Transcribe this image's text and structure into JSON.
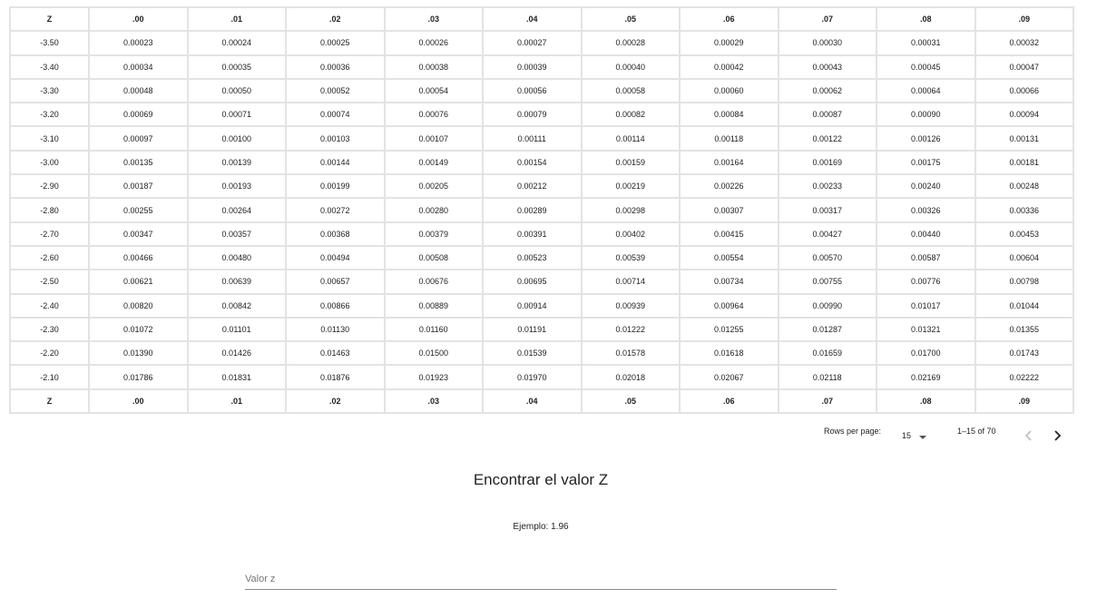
{
  "table": {
    "columns": [
      "Z",
      ".00",
      ".01",
      ".02",
      ".03",
      ".04",
      ".05",
      ".06",
      ".07",
      ".08",
      ".09"
    ],
    "rows": [
      [
        "-3.50",
        "0.00023",
        "0.00024",
        "0.00025",
        "0.00026",
        "0.00027",
        "0.00028",
        "0.00029",
        "0.00030",
        "0.00031",
        "0.00032"
      ],
      [
        "-3.40",
        "0.00034",
        "0.00035",
        "0.00036",
        "0.00038",
        "0.00039",
        "0.00040",
        "0.00042",
        "0.00043",
        "0.00045",
        "0.00047"
      ],
      [
        "-3.30",
        "0.00048",
        "0.00050",
        "0.00052",
        "0.00054",
        "0.00056",
        "0.00058",
        "0.00060",
        "0.00062",
        "0.00064",
        "0.00066"
      ],
      [
        "-3.20",
        "0.00069",
        "0.00071",
        "0.00074",
        "0.00076",
        "0.00079",
        "0.00082",
        "0.00084",
        "0.00087",
        "0.00090",
        "0.00094"
      ],
      [
        "-3.10",
        "0.00097",
        "0.00100",
        "0.00103",
        "0.00107",
        "0.00111",
        "0.00114",
        "0.00118",
        "0.00122",
        "0.00126",
        "0.00131"
      ],
      [
        "-3.00",
        "0.00135",
        "0.00139",
        "0.00144",
        "0.00149",
        "0.00154",
        "0.00159",
        "0.00164",
        "0.00169",
        "0.00175",
        "0.00181"
      ],
      [
        "-2.90",
        "0.00187",
        "0.00193",
        "0.00199",
        "0.00205",
        "0.00212",
        "0.00219",
        "0.00226",
        "0.00233",
        "0.00240",
        "0.00248"
      ],
      [
        "-2.80",
        "0.00255",
        "0.00264",
        "0.00272",
        "0.00280",
        "0.00289",
        "0.00298",
        "0.00307",
        "0.00317",
        "0.00326",
        "0.00336"
      ],
      [
        "-2.70",
        "0.00347",
        "0.00357",
        "0.00368",
        "0.00379",
        "0.00391",
        "0.00402",
        "0.00415",
        "0.00427",
        "0.00440",
        "0.00453"
      ],
      [
        "-2.60",
        "0.00466",
        "0.00480",
        "0.00494",
        "0.00508",
        "0.00523",
        "0.00539",
        "0.00554",
        "0.00570",
        "0.00587",
        "0.00604"
      ],
      [
        "-2.50",
        "0.00621",
        "0.00639",
        "0.00657",
        "0.00676",
        "0.00695",
        "0.00714",
        "0.00734",
        "0.00755",
        "0.00776",
        "0.00798"
      ],
      [
        "-2.40",
        "0.00820",
        "0.00842",
        "0.00866",
        "0.00889",
        "0.00914",
        "0.00939",
        "0.00964",
        "0.00990",
        "0.01017",
        "0.01044"
      ],
      [
        "-2.30",
        "0.01072",
        "0.01101",
        "0.01130",
        "0.01160",
        "0.01191",
        "0.01222",
        "0.01255",
        "0.01287",
        "0.01321",
        "0.01355"
      ],
      [
        "-2.20",
        "0.01390",
        "0.01426",
        "0.01463",
        "0.01500",
        "0.01539",
        "0.01578",
        "0.01618",
        "0.01659",
        "0.01700",
        "0.01743"
      ],
      [
        "-2.10",
        "0.01786",
        "0.01831",
        "0.01876",
        "0.01923",
        "0.01970",
        "0.02018",
        "0.02067",
        "0.02118",
        "0.02169",
        "0.02222"
      ]
    ],
    "footer": [
      "Z",
      ".00",
      ".01",
      ".02",
      ".03",
      ".04",
      ".05",
      ".06",
      ".07",
      ".08",
      ".09"
    ]
  },
  "pagination": {
    "rows_per_page_label": "Rows per page:",
    "rows_per_page_value": "15",
    "range_label": "1–15 of 70",
    "prev_icon": "chevron-left-icon",
    "next_icon": "chevron-right-icon"
  },
  "finder": {
    "title": "Encontrar el valor Z",
    "example": "Ejemplo: 1.96",
    "input_placeholder": "Valor z",
    "input_value": ""
  },
  "colors": {
    "border": "#e3e3e3",
    "text": "#222222",
    "disabled_icon": "#bdbdbd"
  }
}
